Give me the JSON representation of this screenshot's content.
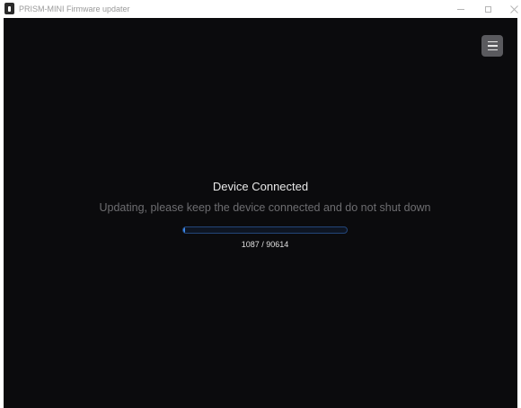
{
  "window": {
    "title": "PRISM-MINI Firmware updater",
    "app_icon": "usb-device-icon",
    "controls": {
      "minimize_icon": "minimize-icon",
      "maximize_icon": "maximize-icon",
      "close_icon": "close-icon"
    }
  },
  "menu": {
    "icon": "hamburger-menu-icon"
  },
  "status": {
    "title": "Device Connected",
    "message": "Updating, please keep the device connected and do not shut down"
  },
  "progress": {
    "current": 1087,
    "total": 90614,
    "text": "1087 / 90614"
  },
  "colors": {
    "background": "#0b0b0d",
    "progress_fill": "#3d8bef",
    "progress_border": "#23467a",
    "menu_button": "#5a5a5e"
  }
}
